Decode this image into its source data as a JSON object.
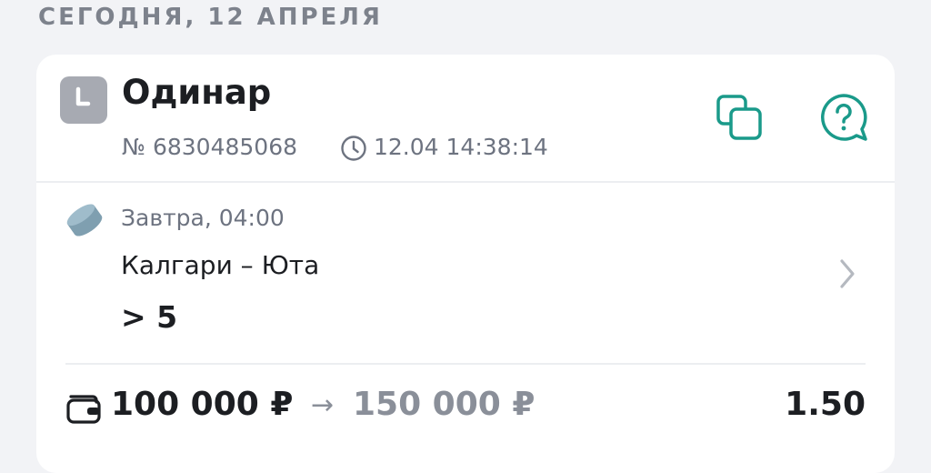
{
  "header": {
    "date": "СЕГОДНЯ, 12 АПРЕЛЯ"
  },
  "bet": {
    "type": "Одинар",
    "number": "№ 6830485068",
    "placed_time": "12.04 14:38:14",
    "status_icon": "clock-icon",
    "actions": {
      "copy_icon": "copy-icon",
      "help_icon": "help-chat-icon"
    }
  },
  "event": {
    "sport_icon": "hockey-puck-icon",
    "start_time": "Завтра, 04:00",
    "name": "Калгари – Юта",
    "selection": "> 5"
  },
  "summary": {
    "stake": "100 000 ₽",
    "arrow": "→",
    "payout": "150 000 ₽",
    "odds": "1.50"
  },
  "colors": {
    "accent": "#1a9a8a",
    "background": "#f2f3f6",
    "card": "#ffffff",
    "muted_text": "#6d7380",
    "status_icon_bg": "#a7aab2",
    "sport_icon": "#7f9fb0"
  }
}
